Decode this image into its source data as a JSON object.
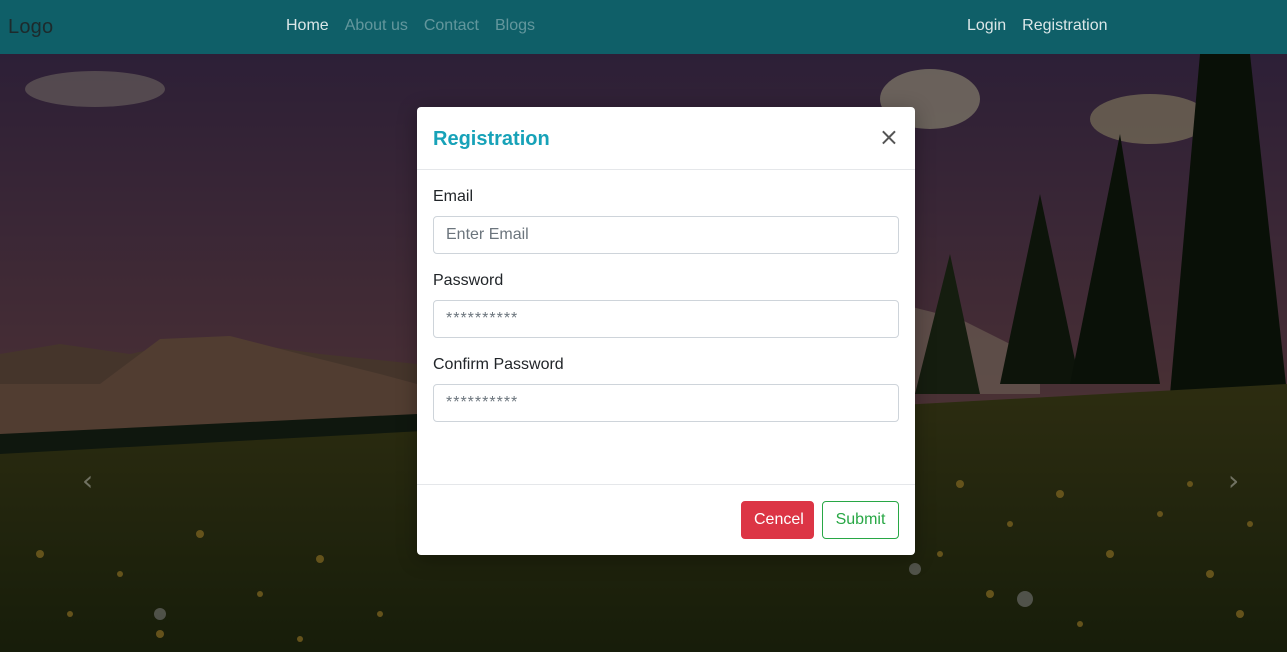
{
  "navbar": {
    "logo": "Logo",
    "links": [
      {
        "label": "Home"
      },
      {
        "label": "About us"
      },
      {
        "label": "Contact"
      },
      {
        "label": "Blogs"
      }
    ],
    "auth": [
      {
        "label": "Login"
      },
      {
        "label": "Registration"
      }
    ],
    "background_color": "#0f5f68"
  },
  "hero": {
    "prev_icon": "chevron-left-icon",
    "next_icon": "chevron-right-icon"
  },
  "modal": {
    "title": "Registration",
    "close_icon": "close-icon",
    "fields": {
      "email": {
        "label": "Email",
        "placeholder": "Enter Email",
        "value": ""
      },
      "password": {
        "label": "Password",
        "placeholder": "**********",
        "value": ""
      },
      "confirm_password": {
        "label": "Confirm Password",
        "placeholder": "**********",
        "value": ""
      }
    },
    "cancel_label": "Cencel",
    "submit_label": "Submit",
    "title_color": "#17a2b8",
    "cancel_color": "#dc3545",
    "submit_color": "#28a745"
  }
}
